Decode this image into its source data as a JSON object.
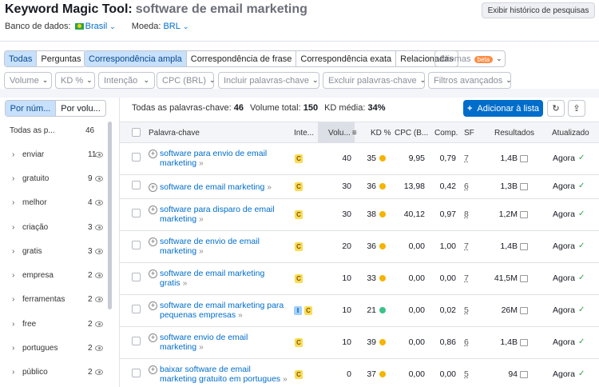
{
  "header": {
    "title": "Keyword Magic Tool:",
    "query": "software de email marketing",
    "history_button": "Exibir histórico de pesquisas",
    "database_label": "Banco de dados:",
    "database_value": "Brasil",
    "currency_label": "Moeda:",
    "currency_value": "BRL"
  },
  "match_tabs": [
    "Todas",
    "Perguntas"
  ],
  "match_types": [
    "Correspondência ampla",
    "Correspondência de frase",
    "Correspondência exata",
    "Relacionadas"
  ],
  "languages": {
    "label": "Idiomas",
    "badge": "beta"
  },
  "filters": [
    "Volume",
    "KD %",
    "Intenção",
    "CPC (BRL)",
    "Incluir palavras-chave",
    "Excluir palavras-chave",
    "Filtros avançados"
  ],
  "sidebar": {
    "tabs": [
      "Por núm...",
      "Por volu..."
    ],
    "all_label": "Todas as p...",
    "all_count": "46",
    "items": [
      {
        "kw": "enviar",
        "n": "11"
      },
      {
        "kw": "gratuito",
        "n": "9"
      },
      {
        "kw": "melhor",
        "n": "4"
      },
      {
        "kw": "criação",
        "n": "3"
      },
      {
        "kw": "gratis",
        "n": "3"
      },
      {
        "kw": "empresa",
        "n": "2"
      },
      {
        "kw": "ferramentas",
        "n": "2"
      },
      {
        "kw": "free",
        "n": "2"
      },
      {
        "kw": "portugues",
        "n": "2"
      },
      {
        "kw": "público",
        "n": "2"
      }
    ]
  },
  "stats": {
    "all_label": "Todas as palavras-chave:",
    "all_value": "46",
    "volume_label": "Volume total:",
    "volume_value": "150",
    "kd_label": "KD média:",
    "kd_value": "34%"
  },
  "add_button": "Adicionar à lista",
  "columns": [
    "Palavra-chave",
    "Inte...",
    "Volu...",
    "KD %",
    "CPC (B...",
    "Comp.",
    "SF",
    "Resultados",
    "Atualizado"
  ],
  "rows": [
    {
      "kw": "software para envio de email marketing",
      "intent": [
        "C"
      ],
      "volume": "40",
      "kd": "35",
      "kd_color": "#f5b400",
      "cpc": "9,95",
      "comp": "0,79",
      "sf": "7",
      "results": "1,4B",
      "updated": "Agora"
    },
    {
      "kw": "software de email marketing",
      "intent": [
        "C"
      ],
      "volume": "30",
      "kd": "36",
      "kd_color": "#f5b400",
      "cpc": "13,98",
      "comp": "0,42",
      "sf": "6",
      "results": "1,3B",
      "updated": "Agora"
    },
    {
      "kw": "software para disparo de email marketing",
      "intent": [
        "C"
      ],
      "volume": "30",
      "kd": "38",
      "kd_color": "#f5b400",
      "cpc": "40,12",
      "comp": "0,97",
      "sf": "8",
      "results": "1,2M",
      "updated": "Agora"
    },
    {
      "kw": "software de envio de email marketing",
      "intent": [
        "C"
      ],
      "volume": "20",
      "kd": "36",
      "kd_color": "#f5b400",
      "cpc": "0,00",
      "comp": "1,00",
      "sf": "7",
      "results": "1,4B",
      "updated": "Agora"
    },
    {
      "kw": "software de email marketing gratis",
      "intent": [
        "C"
      ],
      "volume": "10",
      "kd": "33",
      "kd_color": "#f5b400",
      "cpc": "0,00",
      "comp": "0,00",
      "sf": "7",
      "results": "41,5M",
      "updated": "Agora"
    },
    {
      "kw": "software de email marketing para pequenas empresas",
      "intent": [
        "I",
        "C"
      ],
      "volume": "10",
      "kd": "21",
      "kd_color": "#3ac28a",
      "cpc": "0,00",
      "comp": "0,02",
      "sf": "5",
      "results": "26M",
      "updated": "Agora"
    },
    {
      "kw": "software envio de email marketing",
      "intent": [
        "C"
      ],
      "volume": "10",
      "kd": "39",
      "kd_color": "#f5b400",
      "cpc": "0,00",
      "comp": "0,86",
      "sf": "6",
      "results": "1,4B",
      "updated": "Agora"
    },
    {
      "kw": "baixar software de email marketing gratuito em portugues",
      "intent": [
        "C"
      ],
      "volume": "0",
      "kd": "37",
      "kd_color": "#f5b400",
      "cpc": "0,00",
      "comp": "0,00",
      "sf": "5",
      "results": "94",
      "updated": "Agora"
    }
  ]
}
